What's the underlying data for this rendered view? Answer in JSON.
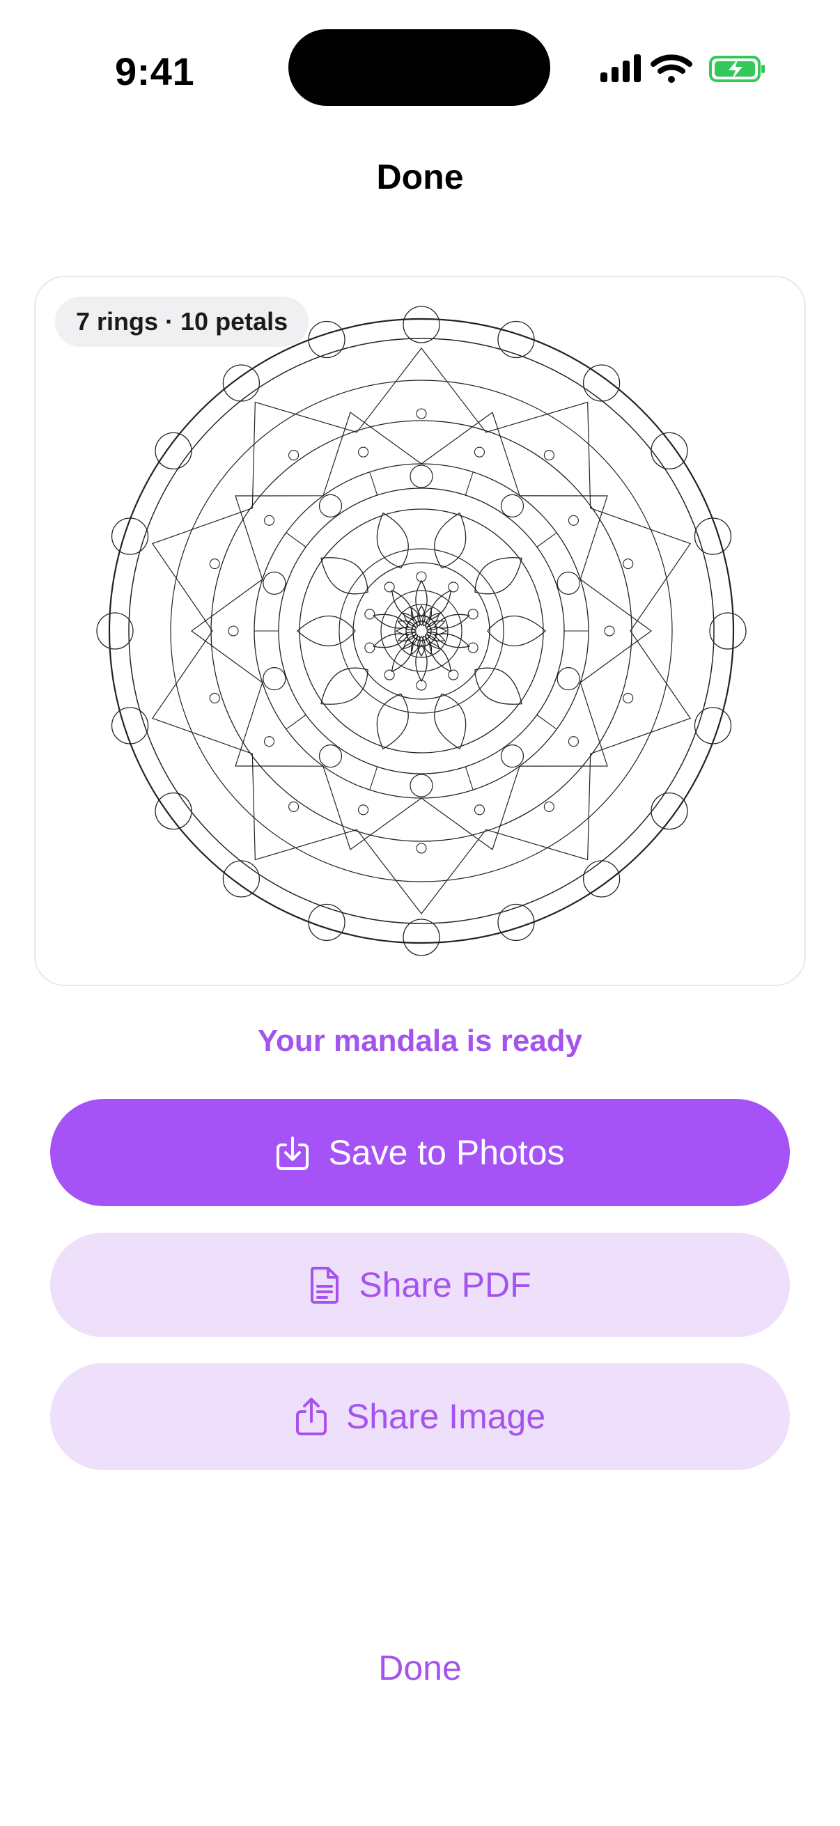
{
  "status_bar": {
    "time": "9:41",
    "icons": [
      "cellular-signal-icon",
      "wifi-icon",
      "battery-charging-icon"
    ]
  },
  "nav": {
    "title": "Done"
  },
  "preview": {
    "badge": "7 rings · 10 petals"
  },
  "message": "Your mandala is ready",
  "actions": {
    "save": {
      "label": "Save to Photos",
      "icon": "save-download-icon"
    },
    "pdf": {
      "label": "Share PDF",
      "icon": "document-icon"
    },
    "image": {
      "label": "Share Image",
      "icon": "share-upload-icon"
    }
  },
  "footer": {
    "done_label": "Done"
  },
  "colors": {
    "accent": "#a553f7",
    "accent_text": "#a553ee",
    "secondary_bg": "#eee0fb",
    "battery": "#34c759"
  }
}
